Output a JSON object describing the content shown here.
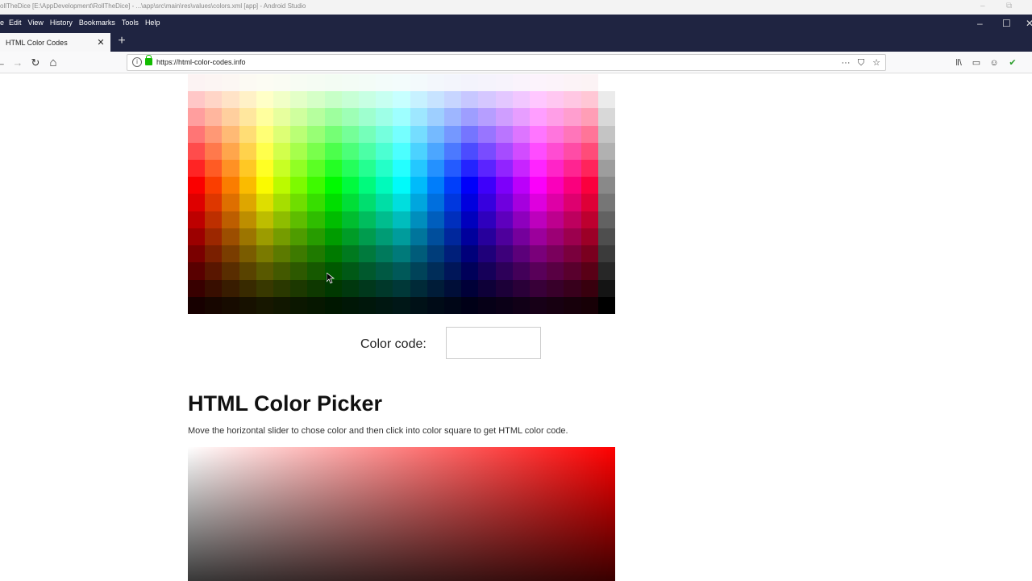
{
  "ide_bar": {
    "title": "ollTheDice [E:\\AppDevelopment\\RollTheDice] - ...\\app\\src\\main\\res\\values\\colors.xml [app] - Android Studio",
    "minimize": "–",
    "restore": "⧉"
  },
  "menu": [
    "Edit",
    "View",
    "History",
    "Bookmarks",
    "Tools",
    "Help"
  ],
  "tab": {
    "label": "HTML Color Codes",
    "close": "✕"
  },
  "new_tab": "+",
  "window": {
    "minimize": "–",
    "maximize": "☐",
    "close": "✕"
  },
  "nav": {
    "back": "←",
    "forward": "→",
    "reload": "↻",
    "home": "⌂"
  },
  "address": {
    "url": "https://html-color-codes.info",
    "info": "i"
  },
  "url_icons": {
    "more": "···",
    "pocket": "⛉",
    "bookmark": "☆"
  },
  "toolbar_icons": {
    "library": "‖\\",
    "sidebar": "▭",
    "account": "☺",
    "extension": "✔"
  },
  "color_grid": {
    "columns": 25,
    "rows": 14
  },
  "color_code": {
    "label": "Color code:",
    "value": ""
  },
  "picker": {
    "heading": "HTML Color Picker",
    "description": "Move the horizontal slider to chose color and then click into color square to get HTML color code.",
    "hue_color": "#ff0000"
  }
}
